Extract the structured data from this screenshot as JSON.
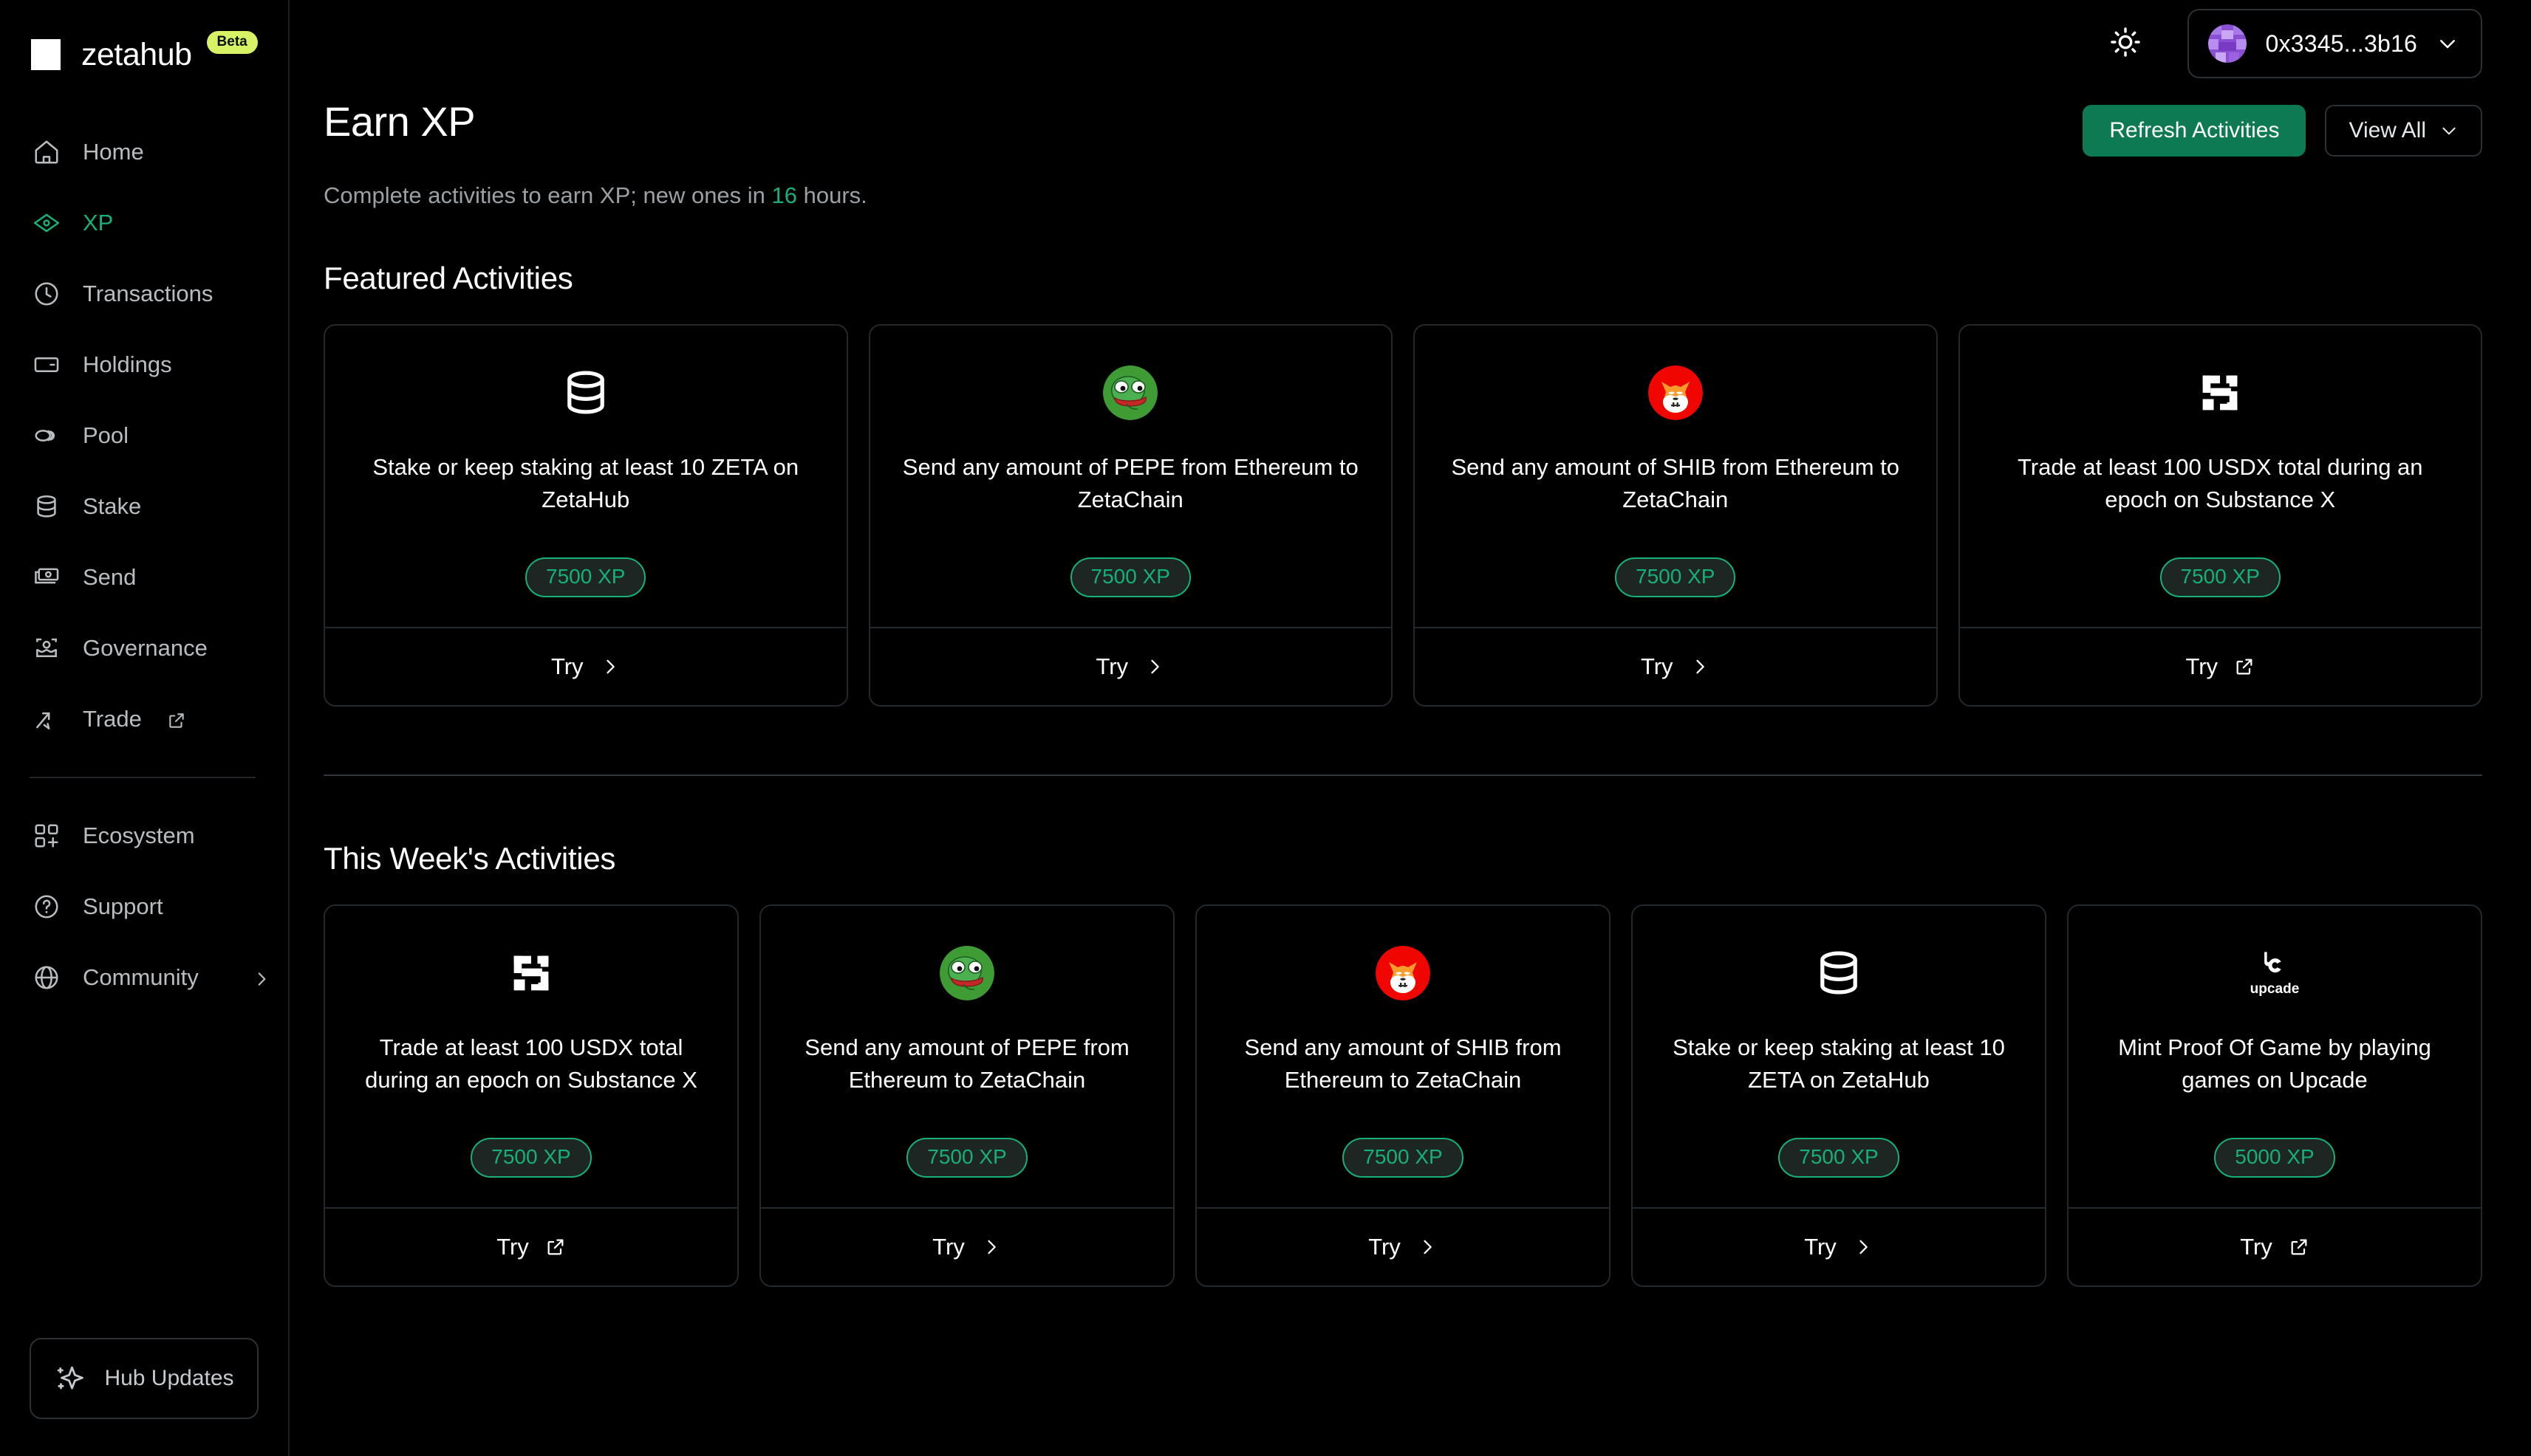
{
  "brand": {
    "name": "zetahub",
    "badge": "Beta",
    "logo_icon": "zetahub-z-logo"
  },
  "sidebar": {
    "items": [
      {
        "label": "Home",
        "icon": "home-icon",
        "active": false
      },
      {
        "label": "XP",
        "icon": "xp-diamond-icon",
        "active": true
      },
      {
        "label": "Transactions",
        "icon": "clock-icon",
        "active": false
      },
      {
        "label": "Holdings",
        "icon": "card-icon",
        "active": false
      },
      {
        "label": "Pool",
        "icon": "pool-rings-icon",
        "active": false
      },
      {
        "label": "Stake",
        "icon": "database-icon",
        "active": false
      },
      {
        "label": "Send",
        "icon": "banknote-icon",
        "active": false
      },
      {
        "label": "Governance",
        "icon": "governance-icon",
        "active": false
      },
      {
        "label": "Trade",
        "icon": "trade-arrows-icon",
        "active": false,
        "external": true
      }
    ],
    "secondary_items": [
      {
        "label": "Ecosystem",
        "icon": "grid-plus-icon"
      },
      {
        "label": "Support",
        "icon": "question-circle-icon"
      },
      {
        "label": "Community",
        "icon": "globe-icon",
        "chevron": true
      }
    ],
    "hub_updates": {
      "label": "Hub Updates",
      "icon": "sparkle-icon"
    }
  },
  "topbar": {
    "theme_toggle_icon": "sun-icon",
    "wallet": {
      "address": "0x3345...3b16",
      "avatar_icon": "wallet-avatar",
      "chevron_icon": "chevron-down-icon"
    }
  },
  "header": {
    "title": "Earn XP",
    "subtitle_before": "Complete activities to earn XP; new ones in ",
    "subtitle_highlight": "16",
    "subtitle_after": " hours.",
    "refresh_label": "Refresh Activities",
    "view_all_label": "View All",
    "accent_color": "#17b079",
    "primary_button_color": "#0d7a54"
  },
  "sections": [
    {
      "title": "Featured Activities",
      "cards": [
        {
          "icon": "database-icon",
          "description": "Stake or keep staking at least 10 ZETA on ZetaHub",
          "xp": "7500 XP",
          "cta": "Try",
          "cta_icon": "chevron-right-icon"
        },
        {
          "icon": "pepe-token-icon",
          "description": "Send any amount of PEPE from Ethereum to ZetaChain",
          "xp": "7500 XP",
          "cta": "Try",
          "cta_icon": "chevron-right-icon"
        },
        {
          "icon": "shib-token-icon",
          "description": "Send any amount of SHIB from Ethereum to ZetaChain",
          "xp": "7500 XP",
          "cta": "Try",
          "cta_icon": "chevron-right-icon"
        },
        {
          "icon": "substance-x-icon",
          "description": "Trade at least 100 USDX total during an epoch on Substance X",
          "xp": "7500 XP",
          "cta": "Try",
          "cta_icon": "external-link-icon"
        }
      ]
    },
    {
      "title": "This Week's Activities",
      "cards": [
        {
          "icon": "substance-x-icon",
          "description": "Trade at least 100 USDX total during an epoch on Substance X",
          "xp": "7500 XP",
          "cta": "Try",
          "cta_icon": "external-link-icon"
        },
        {
          "icon": "pepe-token-icon",
          "description": "Send any amount of PEPE from Ethereum to ZetaChain",
          "xp": "7500 XP",
          "cta": "Try",
          "cta_icon": "chevron-right-icon"
        },
        {
          "icon": "shib-token-icon",
          "description": "Send any amount of SHIB from Ethereum to ZetaChain",
          "xp": "7500 XP",
          "cta": "Try",
          "cta_icon": "chevron-right-icon"
        },
        {
          "icon": "database-icon",
          "description": "Stake or keep staking at least 10 ZETA on ZetaHub",
          "xp": "7500 XP",
          "cta": "Try",
          "cta_icon": "chevron-right-icon"
        },
        {
          "icon": "upcade-icon",
          "description": "Mint Proof Of Game by playing games on Upcade",
          "xp": "5000 XP",
          "cta": "Try",
          "cta_icon": "external-link-icon"
        }
      ]
    }
  ]
}
